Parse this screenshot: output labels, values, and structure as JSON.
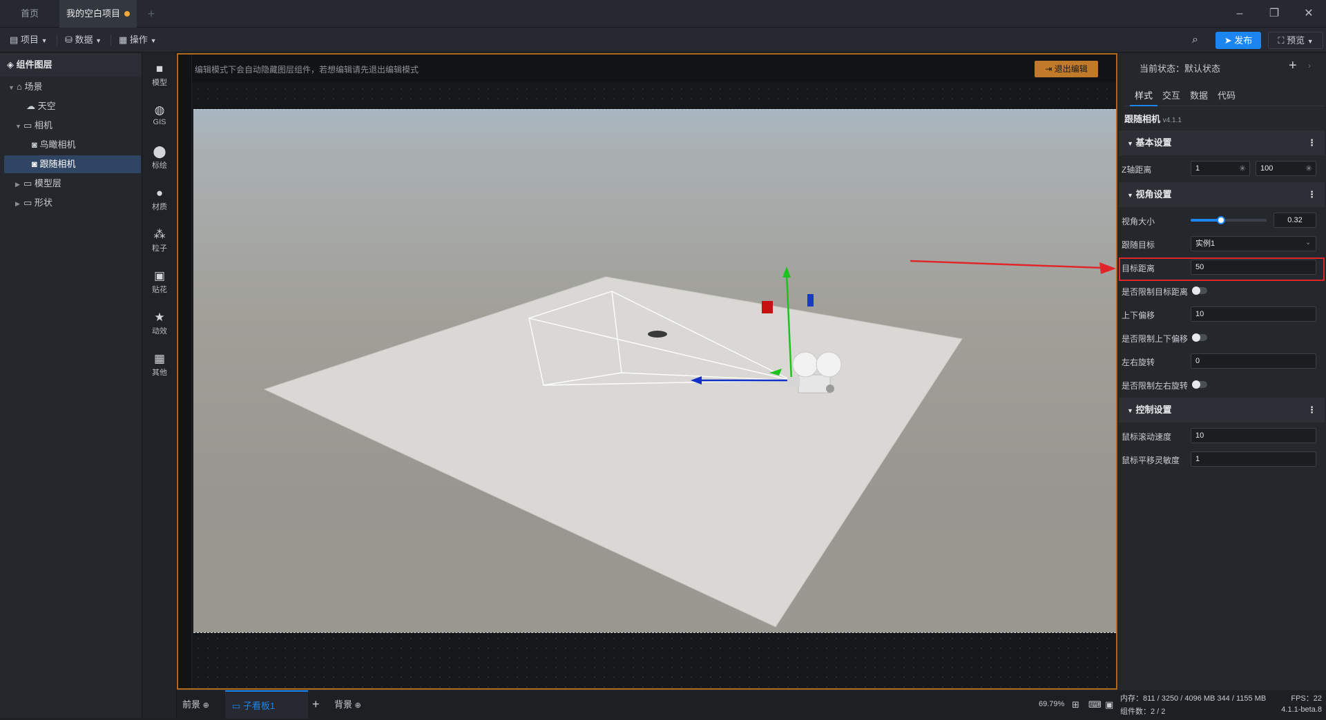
{
  "titlebar": {
    "tabs": [
      {
        "label": "首页"
      },
      {
        "label": "我的空白项目"
      }
    ],
    "add": "+",
    "win": {
      "minimize": "–",
      "restore": "❐",
      "close": "✕"
    }
  },
  "menubar": {
    "project": "项目",
    "data": "数据",
    "ops": "操作",
    "publish": "发布",
    "preview": "预览"
  },
  "layers": {
    "title": "组件图层",
    "items": [
      {
        "label": "场景"
      },
      {
        "label": "天空"
      },
      {
        "label": "相机"
      },
      {
        "label": "鸟瞰相机"
      },
      {
        "label": "跟随相机"
      },
      {
        "label": "模型层"
      },
      {
        "label": "形状"
      }
    ]
  },
  "toolbox": {
    "items": [
      {
        "label": "模型",
        "icon": "cube-icon"
      },
      {
        "label": "GIS",
        "icon": "globe-icon"
      },
      {
        "label": "标绘",
        "icon": "pin-icon"
      },
      {
        "label": "材质",
        "icon": "sphere-icon"
      },
      {
        "label": "粒子",
        "icon": "particle-icon"
      },
      {
        "label": "贴花",
        "icon": "image-icon"
      },
      {
        "label": "动效",
        "icon": "star-icon"
      },
      {
        "label": "其他",
        "icon": "grid-icon"
      }
    ]
  },
  "stage": {
    "tip": "编辑模式下会自动隐藏图层组件，若想编辑请先退出编辑模式",
    "exit": "退出编辑"
  },
  "bottom": {
    "front": "前景",
    "board": "子看板1",
    "add": "+",
    "back": "背景",
    "zoom": "69.79%"
  },
  "props": {
    "state_label": "当前状态：默认状态",
    "tabs": [
      "样式",
      "交互",
      "数据",
      "代码"
    ],
    "component": "跟随相机",
    "version": "v4.1.1",
    "sections": {
      "basic": "基本设置",
      "view": "视角设置",
      "control": "控制设置"
    },
    "z_label": "Z轴距离",
    "z_min": "1",
    "z_max": "100",
    "fov_label": "视角大小",
    "fov_value": "0.32",
    "fov_fraction": 0.4,
    "target_label": "跟随目标",
    "target_value": "实例1",
    "dist_label": "目标距离",
    "dist_value": "50",
    "limit_dist_label": "是否限制目标距离",
    "offset_label": "上下偏移",
    "offset_value": "10",
    "limit_offset_label": "是否限制上下偏移",
    "rotate_label": "左右旋转",
    "rotate_value": "0",
    "limit_rotate_label": "是否限制左右旋转",
    "scroll_label": "鼠标滚动速度",
    "scroll_value": "10",
    "pan_label": "鼠标平移灵敏度",
    "pan_value": "1"
  },
  "status": {
    "memory": "内存：811 / 3250 / 4096 MB 344 / 1155 MB",
    "fps": "FPS：22",
    "count": "组件数：2 / 2",
    "version": "4.1.1-beta.8"
  },
  "colors": {
    "accent": "#1b86f2",
    "frame": "#b06a1e",
    "highlight": "#e0252b"
  }
}
